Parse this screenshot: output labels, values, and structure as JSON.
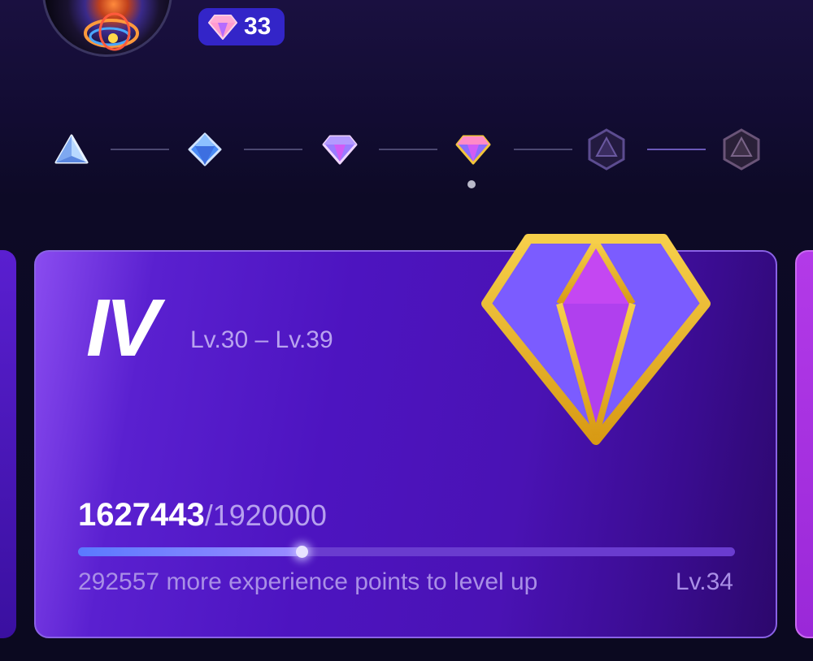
{
  "profile": {
    "avatar_icon": "avatar-image",
    "gem_count": "33",
    "gem_icon": "diamond-icon"
  },
  "tier_track": {
    "tiers": [
      {
        "icon": "triangle-gem-icon",
        "state": "completed"
      },
      {
        "icon": "octahedron-gem-icon",
        "state": "completed"
      },
      {
        "icon": "diamond-gem-icon",
        "state": "completed"
      },
      {
        "icon": "diamond-gem-icon",
        "state": "current"
      },
      {
        "icon": "locked-hexagon-gem-icon",
        "state": "locked"
      },
      {
        "icon": "locked-hexagon-gem-icon",
        "state": "locked"
      }
    ],
    "current_index": 3
  },
  "card": {
    "tier_numeral": "IV",
    "level_range": "Lv.30 – Lv.39",
    "experience_current": "1627443",
    "experience_total": "/1920000",
    "progress_fraction": 0.34,
    "hint": "292557 more experience points to level up",
    "next_level": "Lv.34",
    "tier_icon": "gold-diamond-icon"
  },
  "colors": {
    "accent": "#3325c8",
    "card_purple": "#4d14c0",
    "gold": "#e8b526",
    "gem_violet": "#7b5cff",
    "gem_magenta": "#c447f2"
  }
}
